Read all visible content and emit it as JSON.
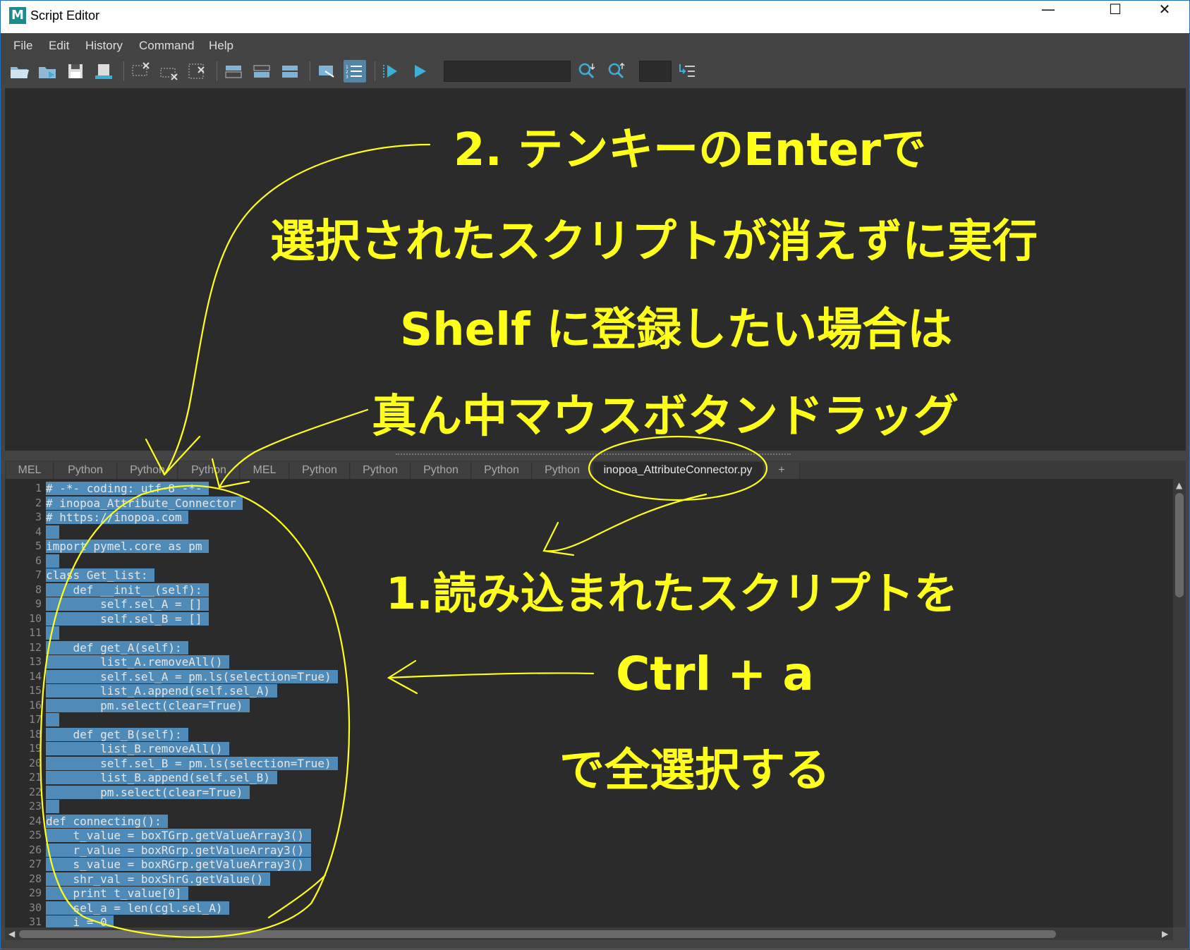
{
  "window": {
    "title": "Script Editor",
    "icon_letter": "M"
  },
  "window_controls": {
    "minimize": "—",
    "maximize": "☐",
    "close": "✕"
  },
  "menu": [
    "File",
    "Edit",
    "History",
    "Command",
    "Help"
  ],
  "toolbar_icons": [
    "load-script-icon",
    "source-script-icon",
    "save-script-icon",
    "save-to-shelf-icon",
    "clear-history-icon",
    "clear-input-icon",
    "clear-all-icon",
    "show-history-icon",
    "show-input-icon",
    "show-both-icon",
    "echo-commands-icon",
    "line-numbers-icon",
    "execute-all-icon",
    "execute-icon",
    "search-down-icon",
    "search-up-icon",
    "goto-line-icon"
  ],
  "tabs": [
    "MEL",
    "Python",
    "Python",
    "Python",
    "MEL",
    "Python",
    "Python",
    "Python",
    "Python",
    "Python",
    "inopoa_AttributeConnector.py",
    "+"
  ],
  "active_tab": "inopoa_AttributeConnector.py",
  "code_lines": [
    "# -*- coding: utf-8 -*-",
    "# inopoa_Attribute_Connector",
    "# https://inopoa.com",
    "",
    "import pymel.core as pm",
    "",
    "class Get_list:",
    "    def __init__(self):",
    "        self.sel_A = []",
    "        self.sel_B = []",
    "",
    "    def get_A(self):",
    "        list_A.removeAll()",
    "        self.sel_A = pm.ls(selection=True)",
    "        list_A.append(self.sel_A)",
    "        pm.select(clear=True)",
    "",
    "    def get_B(self):",
    "        list_B.removeAll()",
    "        self.sel_B = pm.ls(selection=True)",
    "        list_B.append(self.sel_B)",
    "        pm.select(clear=True)",
    "",
    "def connecting():",
    "    t_value = boxTGrp.getValueArray3()",
    "    r_value = boxRGrp.getValueArray3()",
    "    s_value = boxRGrp.getValueArray3()",
    "    shr_val = boxShrG.getValue()",
    "    print t_value[0]",
    "    sel_a = len(cgl.sel_A)",
    "    i = 0"
  ],
  "annotations": {
    "step2_line1": "2. テンキーのEnterで",
    "step2_line2": "選択されたスクリプトが消えずに実行",
    "step2_line3": "Shelf に登録したい場合は",
    "step2_line4": "真ん中マウスボタンドラッグ",
    "step1_line1": "1.読み込まれたスクリプトを",
    "step1_line2": "Ctrl + a",
    "step1_line3": "で全選択する"
  },
  "colors": {
    "annotation": "#ffff1a",
    "selection": "#4f8bb8",
    "editor_bg": "#2b2b2b"
  }
}
